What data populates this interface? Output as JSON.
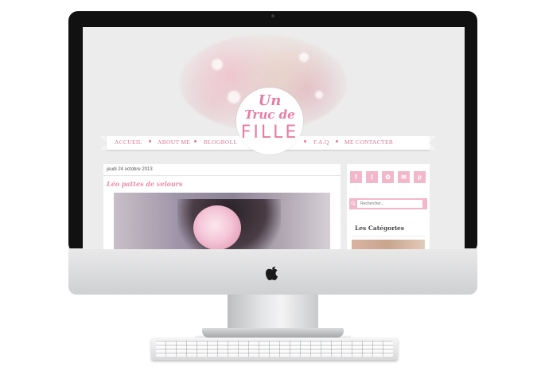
{
  "site": {
    "logo": {
      "line1": "Un",
      "line2": "Truc de",
      "line3": "FILLE"
    },
    "nav": [
      "ACCUEIL",
      "ABOUT ME",
      "BLOGROLL",
      "F.A.Q",
      "ME CONTACTER"
    ],
    "post": {
      "date": "jeudi 24 octobre 2013",
      "title": "Léo pattes de velours"
    },
    "sidebar": {
      "social_icons": [
        "facebook-icon",
        "twitter-icon",
        "instagram-icon",
        "email-icon",
        "pinterest-icon"
      ],
      "social_glyphs": [
        "f",
        "t",
        "✿",
        "✉",
        "p"
      ],
      "search_placeholder": "Rechercher...",
      "categories_heading": "Les Catégories"
    }
  },
  "colors": {
    "accent": "#e87ca0",
    "soft_pink": "#f3b7ca"
  }
}
